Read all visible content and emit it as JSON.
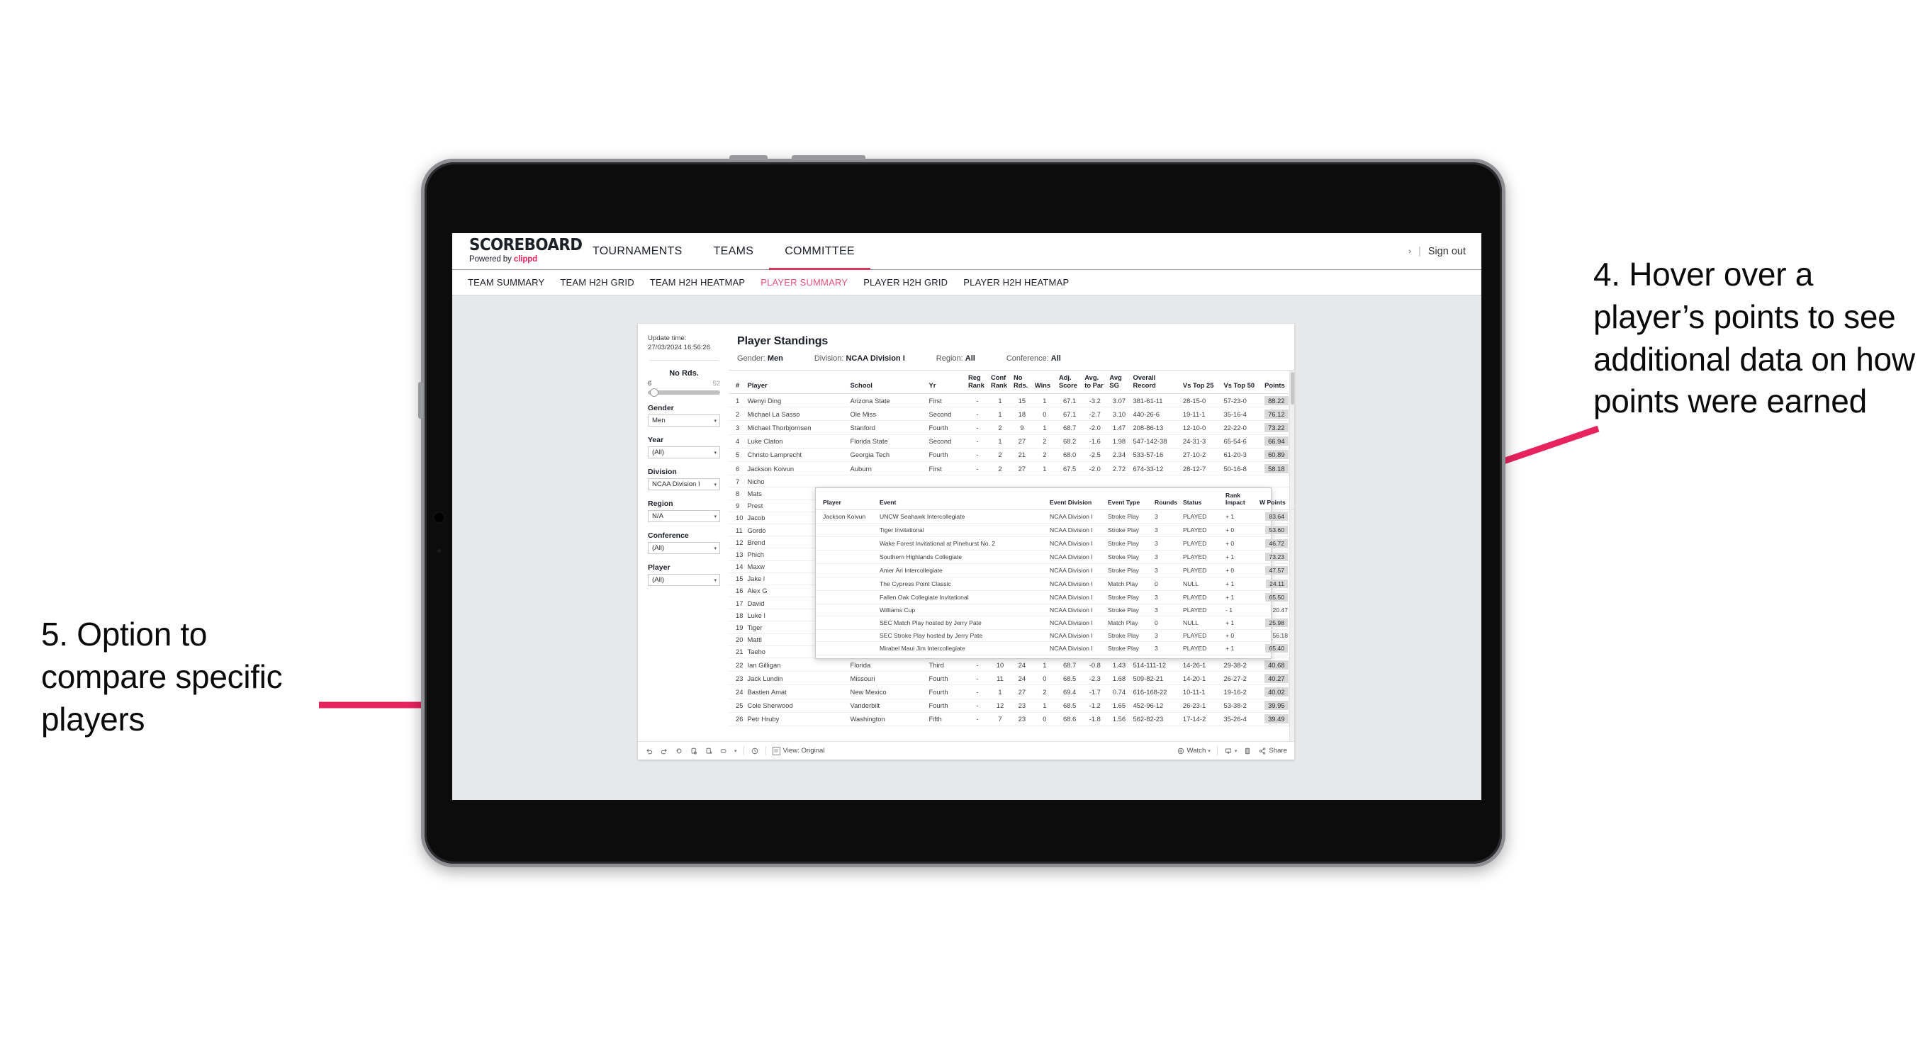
{
  "annotations": {
    "right": "4. Hover over a player’s points to see additional data on how points were earned",
    "left": "5. Option to compare specific players",
    "arrow_color": "#e8245e"
  },
  "app": {
    "logo_main": "SCOREBOARD",
    "logo_sub_prefix": "Powered by ",
    "logo_brand": "clippd",
    "nav": [
      {
        "label": "TOURNAMENTS",
        "active": false
      },
      {
        "label": "TEAMS",
        "active": false
      },
      {
        "label": "COMMITTEE",
        "active": true
      }
    ],
    "account_chevron": "›",
    "separator": "|",
    "sign_out": "Sign out",
    "subtabs": [
      {
        "label": "TEAM SUMMARY",
        "active": false
      },
      {
        "label": "TEAM H2H GRID",
        "active": false
      },
      {
        "label": "TEAM H2H HEATMAP",
        "active": false
      },
      {
        "label": "PLAYER SUMMARY",
        "active": true
      },
      {
        "label": "PLAYER H2H GRID",
        "active": false
      },
      {
        "label": "PLAYER H2H HEATMAP",
        "active": false
      }
    ]
  },
  "rail": {
    "update_label": "Update time:",
    "update_value": "27/03/2024 16:56:26",
    "slider": {
      "title": "No Rds.",
      "min": "6",
      "max": "52"
    },
    "filters": [
      {
        "label": "Gender",
        "value": "Men"
      },
      {
        "label": "Year",
        "value": "(All)"
      },
      {
        "label": "Division",
        "value": "NCAA Division I"
      },
      {
        "label": "Region",
        "value": "N/A"
      },
      {
        "label": "Conference",
        "value": "(All)"
      },
      {
        "label": "Player",
        "value": "(All)"
      }
    ],
    "caret": "▾"
  },
  "viz": {
    "title": "Player Standings",
    "meta": [
      {
        "label": "Gender: ",
        "value": "Men"
      },
      {
        "label": "Division: ",
        "value": "NCAA Division I"
      },
      {
        "label": "Region: ",
        "value": "All"
      },
      {
        "label": "Conference: ",
        "value": "All"
      }
    ],
    "columns": [
      "#",
      "Player",
      "School",
      "Yr",
      "Reg Rank",
      "Conf Rank",
      "No Rds.",
      "Wins",
      "Adj. Score",
      "Avg. to Par",
      "Avg SG",
      "Overall Record",
      "Vs Top 25",
      "Vs Top 50",
      "Points"
    ],
    "columns_split": [
      {
        "l1": "#",
        "l2": ""
      },
      {
        "l1": "Player",
        "l2": ""
      },
      {
        "l1": "School",
        "l2": ""
      },
      {
        "l1": "Yr",
        "l2": ""
      },
      {
        "l1": "Reg",
        "l2": "Rank"
      },
      {
        "l1": "Conf",
        "l2": "Rank"
      },
      {
        "l1": "No",
        "l2": "Rds."
      },
      {
        "l1": "Wins",
        "l2": ""
      },
      {
        "l1": "Adj.",
        "l2": "Score"
      },
      {
        "l1": "Avg.",
        "l2": "to Par"
      },
      {
        "l1": "Avg",
        "l2": "SG"
      },
      {
        "l1": "Overall",
        "l2": "Record"
      },
      {
        "l1": "Vs Top 25",
        "l2": ""
      },
      {
        "l1": "Vs Top 50",
        "l2": ""
      },
      {
        "l1": "Points",
        "l2": ""
      }
    ],
    "rows": [
      [
        "1",
        "Wenyi Ding",
        "Arizona State",
        "First",
        "-",
        "1",
        "15",
        "1",
        "67.1",
        "-3.2",
        "3.07",
        "381-61-11",
        "28-15-0",
        "57-23-0",
        "88.22"
      ],
      [
        "2",
        "Michael La Sasso",
        "Ole Miss",
        "Second",
        "-",
        "1",
        "18",
        "0",
        "67.1",
        "-2.7",
        "3.10",
        "440-26-6",
        "19-11-1",
        "35-16-4",
        "76.12"
      ],
      [
        "3",
        "Michael Thorbjornsen",
        "Stanford",
        "Fourth",
        "-",
        "2",
        "9",
        "1",
        "68.7",
        "-2.0",
        "1.47",
        "208-86-13",
        "12-10-0",
        "22-22-0",
        "73.22"
      ],
      [
        "4",
        "Luke Claton",
        "Florida State",
        "Second",
        "-",
        "1",
        "27",
        "2",
        "68.2",
        "-1.6",
        "1.98",
        "547-142-38",
        "24-31-3",
        "65-54-6",
        "66.94"
      ],
      [
        "5",
        "Christo Lamprecht",
        "Georgia Tech",
        "Fourth",
        "-",
        "2",
        "21",
        "2",
        "68.0",
        "-2.5",
        "2.34",
        "533-57-16",
        "27-10-2",
        "61-20-3",
        "60.89"
      ],
      [
        "6",
        "Jackson Koivun",
        "Auburn",
        "First",
        "-",
        "2",
        "27",
        "1",
        "67.5",
        "-2.0",
        "2.72",
        "674-33-12",
        "28-12-7",
        "50-16-8",
        "58.18"
      ],
      [
        "7",
        "Nicho",
        "",
        "",
        "",
        "",
        "",
        "",
        "",
        "",
        "",
        "",
        "",
        "",
        ""
      ],
      [
        "8",
        "Mats",
        "",
        "",
        "",
        "",
        "",
        "",
        "",
        "",
        "",
        "",
        "",
        "",
        ""
      ],
      [
        "9",
        "Prest",
        "",
        "",
        "",
        "",
        "",
        "",
        "",
        "",
        "",
        "",
        "",
        "",
        ""
      ],
      [
        "10",
        "Jacob",
        "",
        "",
        "",
        "",
        "",
        "",
        "",
        "",
        "",
        "",
        "",
        "",
        ""
      ],
      [
        "11",
        "Gordo",
        "",
        "",
        "",
        "",
        "",
        "",
        "",
        "",
        "",
        "",
        "",
        "",
        ""
      ],
      [
        "12",
        "Brend",
        "",
        "",
        "",
        "",
        "",
        "",
        "",
        "",
        "",
        "",
        "",
        "",
        ""
      ],
      [
        "13",
        "Phich",
        "",
        "",
        "",
        "",
        "",
        "",
        "",
        "",
        "",
        "",
        "",
        "",
        ""
      ],
      [
        "14",
        "Maxw",
        "",
        "",
        "",
        "",
        "",
        "",
        "",
        "",
        "",
        "",
        "",
        "",
        ""
      ],
      [
        "15",
        "Jake l",
        "",
        "",
        "",
        "",
        "",
        "",
        "",
        "",
        "",
        "",
        "",
        "",
        ""
      ],
      [
        "16",
        "Alex G",
        "",
        "",
        "",
        "",
        "",
        "",
        "",
        "",
        "",
        "",
        "",
        "",
        ""
      ],
      [
        "17",
        "David",
        "",
        "",
        "",
        "",
        "",
        "",
        "",
        "",
        "",
        "",
        "",
        "",
        ""
      ],
      [
        "18",
        "Luke I",
        "",
        "",
        "",
        "",
        "",
        "",
        "",
        "",
        "",
        "",
        "",
        "",
        ""
      ],
      [
        "19",
        "Tiger",
        "",
        "",
        "",
        "",
        "",
        "",
        "",
        "",
        "",
        "",
        "",
        "",
        ""
      ],
      [
        "20",
        "Mattl",
        "",
        "",
        "",
        "",
        "",
        "",
        "",
        "",
        "",
        "",
        "",
        "",
        ""
      ],
      [
        "21",
        "Taeho",
        "",
        "",
        "",
        "",
        "",
        "",
        "",
        "",
        "",
        "",
        "",
        "",
        ""
      ],
      [
        "22",
        "Ian Gilligan",
        "Florida",
        "Third",
        "-",
        "10",
        "24",
        "1",
        "68.7",
        "-0.8",
        "1.43",
        "514-111-12",
        "14-26-1",
        "29-38-2",
        "40.68"
      ],
      [
        "23",
        "Jack Lundin",
        "Missouri",
        "Fourth",
        "-",
        "11",
        "24",
        "0",
        "68.5",
        "-2.3",
        "1.68",
        "509-82-21",
        "14-20-1",
        "26-27-2",
        "40.27"
      ],
      [
        "24",
        "Bastien Amat",
        "New Mexico",
        "Fourth",
        "-",
        "1",
        "27",
        "2",
        "69.4",
        "-1.7",
        "0.74",
        "616-168-22",
        "10-11-1",
        "19-16-2",
        "40.02"
      ],
      [
        "25",
        "Cole Sherwood",
        "Vanderbilt",
        "Fourth",
        "-",
        "12",
        "23",
        "1",
        "68.5",
        "-1.2",
        "1.65",
        "452-96-12",
        "26-23-1",
        "53-38-2",
        "39.95"
      ],
      [
        "26",
        "Petr Hruby",
        "Washington",
        "Fifth",
        "-",
        "7",
        "23",
        "0",
        "68.6",
        "-1.8",
        "1.56",
        "562-82-23",
        "17-14-2",
        "35-26-4",
        "39.49"
      ]
    ]
  },
  "tooltip": {
    "columns_split": [
      {
        "l1": "Player",
        "l2": ""
      },
      {
        "l1": "Event",
        "l2": ""
      },
      {
        "l1": "Event Division",
        "l2": ""
      },
      {
        "l1": "Event Type",
        "l2": ""
      },
      {
        "l1": "Rounds",
        "l2": ""
      },
      {
        "l1": "Status",
        "l2": ""
      },
      {
        "l1": "Rank",
        "l2": "Impact"
      },
      {
        "l1": "W Points",
        "l2": ""
      }
    ],
    "player": "Jackson Koivun",
    "rows": [
      {
        "player": "Jackson Koivun",
        "event": "UNCW Seahawk Intercollegiate",
        "division": "NCAA Division I",
        "type": "Stroke Play",
        "rounds": "3",
        "status": "PLAYED",
        "impact": "+ 1",
        "points": "83.64",
        "highlight": true
      },
      {
        "player": "",
        "event": "Tiger Invitational",
        "division": "NCAA Division I",
        "type": "Stroke Play",
        "rounds": "3",
        "status": "PLAYED",
        "impact": "+ 0",
        "points": "53.60",
        "highlight": true
      },
      {
        "player": "",
        "event": "Wake Forest Invitational at Pinehurst No. 2",
        "division": "NCAA Division I",
        "type": "Stroke Play",
        "rounds": "3",
        "status": "PLAYED",
        "impact": "+ 0",
        "points": "46.72",
        "highlight": true
      },
      {
        "player": "",
        "event": "Southern Highlands Collegiate",
        "division": "NCAA Division I",
        "type": "Stroke Play",
        "rounds": "3",
        "status": "PLAYED",
        "impact": "+ 1",
        "points": "73.23",
        "highlight": true
      },
      {
        "player": "",
        "event": "Amer Ari Intercollegiate",
        "division": "NCAA Division I",
        "type": "Stroke Play",
        "rounds": "3",
        "status": "PLAYED",
        "impact": "+ 0",
        "points": "47.57",
        "highlight": true
      },
      {
        "player": "",
        "event": "The Cypress Point Classic",
        "division": "NCAA Division I",
        "type": "Match Play",
        "rounds": "0",
        "status": "NULL",
        "impact": "+ 1",
        "points": "24.11",
        "highlight": true
      },
      {
        "player": "",
        "event": "Fallen Oak Collegiate Invitational",
        "division": "NCAA Division I",
        "type": "Stroke Play",
        "rounds": "3",
        "status": "PLAYED",
        "impact": "+ 1",
        "points": "65.50",
        "highlight": true
      },
      {
        "player": "",
        "event": "Williams Cup",
        "division": "NCAA Division I",
        "type": "Stroke Play",
        "rounds": "3",
        "status": "PLAYED",
        "impact": "- 1",
        "points": "20.47",
        "highlight": false
      },
      {
        "player": "",
        "event": "SEC Match Play hosted by Jerry Pate",
        "division": "NCAA Division I",
        "type": "Match Play",
        "rounds": "0",
        "status": "NULL",
        "impact": "+ 1",
        "points": "25.98",
        "highlight": true
      },
      {
        "player": "",
        "event": "SEC Stroke Play hosted by Jerry Pate",
        "division": "NCAA Division I",
        "type": "Stroke Play",
        "rounds": "3",
        "status": "PLAYED",
        "impact": "+ 0",
        "points": "56.18",
        "highlight": false
      },
      {
        "player": "",
        "event": "Mirabel Maui Jim Intercollegiate",
        "division": "NCAA Division I",
        "type": "Stroke Play",
        "rounds": "3",
        "status": "PLAYED",
        "impact": "+ 1",
        "points": "65.40",
        "highlight": true
      }
    ]
  },
  "vizbar": {
    "view_label": "View: Original",
    "watch_label": "Watch",
    "share_label": "Share",
    "caret": "▾"
  }
}
